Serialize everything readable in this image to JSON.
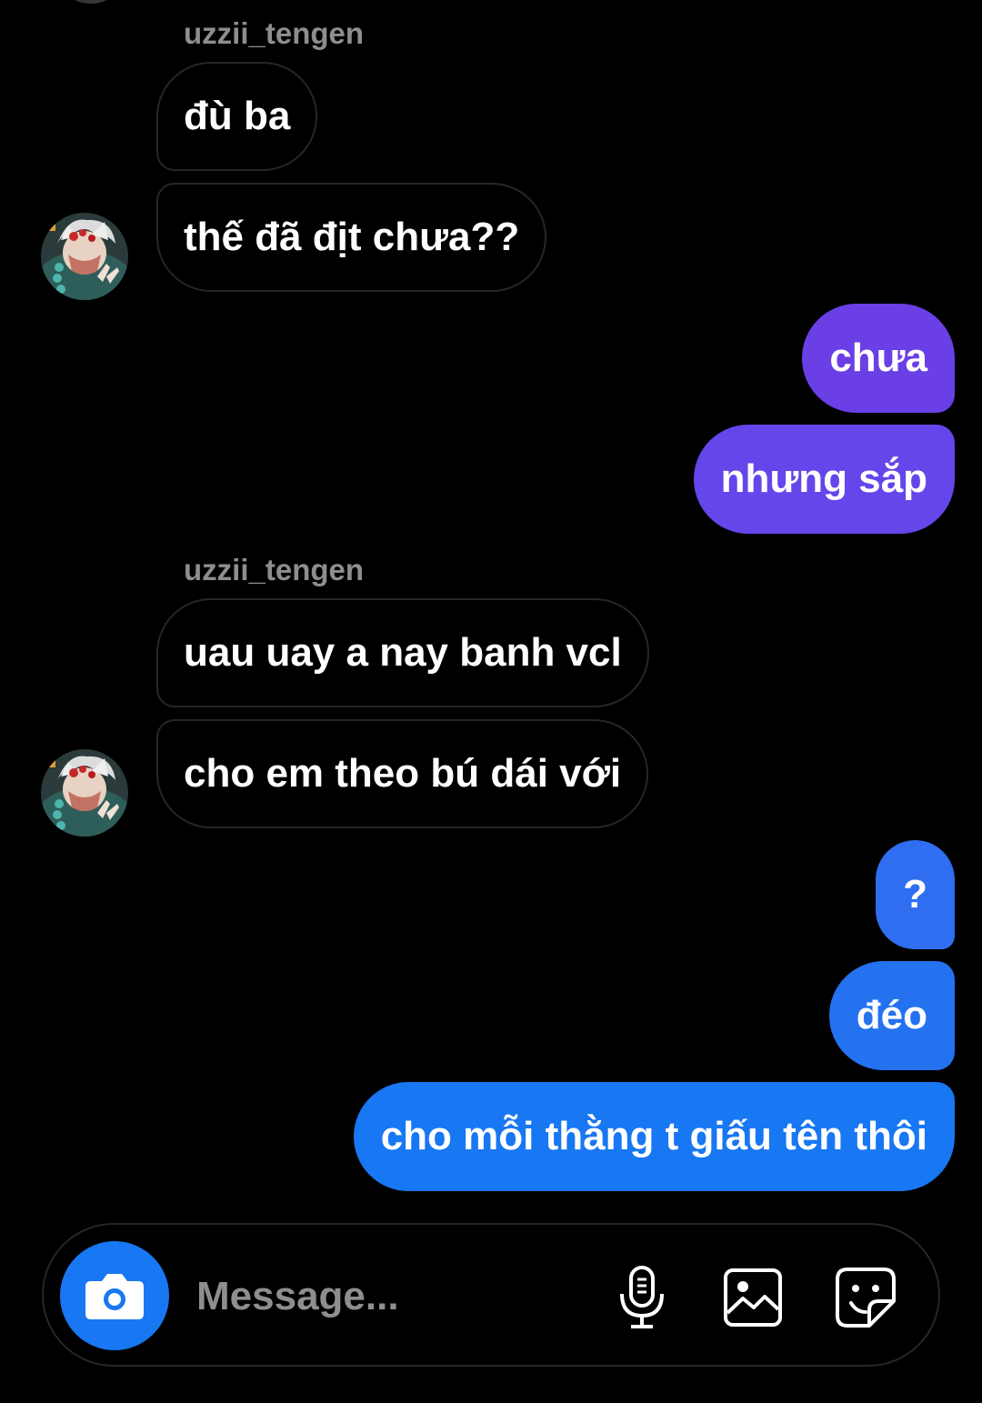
{
  "thread": {
    "messages": [
      {
        "direction": "incoming",
        "sender": "uzzii_tengen",
        "text": "đù ba"
      },
      {
        "direction": "incoming",
        "text": "thế đã địt chưa??"
      },
      {
        "direction": "outgoing",
        "text": "chưa"
      },
      {
        "direction": "outgoing",
        "text": "nhưng sắp"
      },
      {
        "direction": "incoming",
        "sender": "uzzii_tengen",
        "text": "uau uay a nay banh vcl"
      },
      {
        "direction": "incoming",
        "text": "cho em theo bú dái với"
      },
      {
        "direction": "outgoing",
        "text": "?"
      },
      {
        "direction": "outgoing",
        "text": "đéo"
      },
      {
        "direction": "outgoing",
        "text": "cho mỗi thằng t giấu tên thôi"
      }
    ]
  },
  "composer": {
    "placeholder": "Message...",
    "value": "",
    "icons": [
      "camera-icon",
      "microphone-icon",
      "gallery-icon",
      "sticker-icon"
    ]
  },
  "colors": {
    "background": "#000000",
    "incoming_border": "#262626",
    "sender_name": "#8e8e8e",
    "outgoing_purple": "#6b3fe6",
    "outgoing_blue": "#1877f2",
    "camera_button": "#1877f2"
  }
}
